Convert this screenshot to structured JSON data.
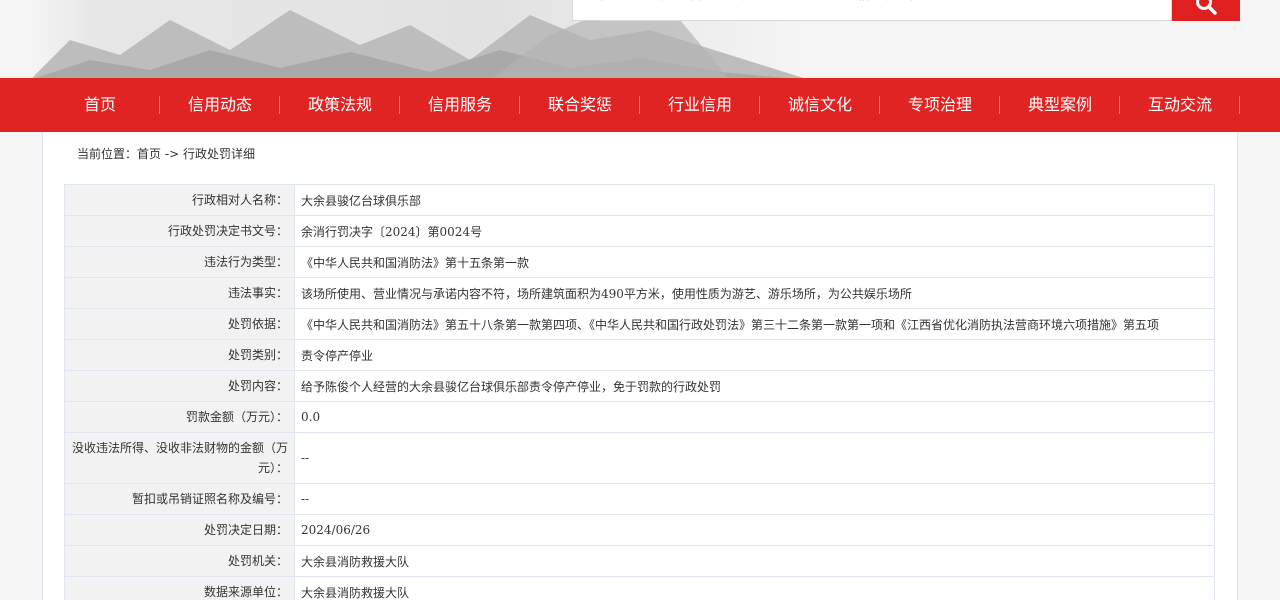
{
  "header": {
    "search_placeholder": "请输入企业（法人名称、工商注册号或统一社会信用代码）"
  },
  "nav": [
    "首页",
    "信用动态",
    "政策法规",
    "信用服务",
    "联合奖惩",
    "行业信用",
    "诚信文化",
    "专项治理",
    "典型案例",
    "互动交流"
  ],
  "breadcrumb": {
    "prefix": "当前位置：",
    "home": "首页",
    "sep": " -> ",
    "current": "行政处罚详细"
  },
  "detail": [
    {
      "label": "行政相对人名称：",
      "value": "大余县骏亿台球俱乐部"
    },
    {
      "label": "行政处罚决定书文号：",
      "value": "余消行罚决字〔2024〕第0024号"
    },
    {
      "label": "违法行为类型：",
      "value": "《中华人民共和国消防法》第十五条第一款"
    },
    {
      "label": "违法事实：",
      "value": "该场所使用、营业情况与承诺内容不符，场所建筑面积为490平方米，使用性质为游艺、游乐场所，为公共娱乐场所"
    },
    {
      "label": "处罚依据：",
      "value": "《中华人民共和国消防法》第五十八条第一款第四项、《中华人民共和国行政处罚法》第三十二条第一款第一项和《江西省优化消防执法营商环境六项措施》第五项"
    },
    {
      "label": "处罚类别：",
      "value": "责令停产停业"
    },
    {
      "label": "处罚内容：",
      "value": "给予陈俊个人经营的大余县骏亿台球俱乐部责令停产停业，免于罚款的行政处罚"
    },
    {
      "label": "罚款金额（万元）：",
      "value": "0.0"
    },
    {
      "label": "没收违法所得、没收非法财物的金额（万元）：",
      "value": "--"
    },
    {
      "label": "暂扣或吊销证照名称及编号：",
      "value": "--"
    },
    {
      "label": "处罚决定日期：",
      "value": "2024/06/26"
    },
    {
      "label": "处罚机关：",
      "value": "大余县消防救援大队"
    },
    {
      "label": "数据来源单位：",
      "value": "大余县消防救援大队"
    }
  ],
  "colors": {
    "nav": "#e02424",
    "search_button": "#e02020"
  },
  "icons": {
    "search": "search-icon"
  }
}
